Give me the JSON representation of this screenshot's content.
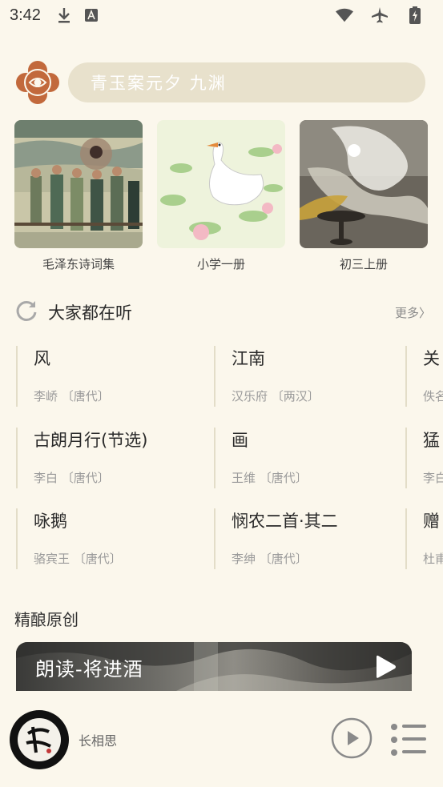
{
  "status": {
    "time": "3:42"
  },
  "search": {
    "text": "青玉案元夕 九渊"
  },
  "books": [
    {
      "caption": "毛泽东诗词集"
    },
    {
      "caption": "小学一册"
    },
    {
      "caption": "初三上册"
    }
  ],
  "popular": {
    "title": "大家都在听",
    "more": "更多〉",
    "poems": [
      {
        "title": "风",
        "author": "李峤 〔唐代〕"
      },
      {
        "title": "江南",
        "author": "汉乐府 〔两汉〕"
      },
      {
        "title": "关",
        "author": "佚名"
      },
      {
        "title": "古朗月行(节选)",
        "author": "李白 〔唐代〕"
      },
      {
        "title": "画",
        "author": "王维 〔唐代〕"
      },
      {
        "title": "猛",
        "author": "李白"
      },
      {
        "title": "咏鹅",
        "author": "骆宾王 〔唐代〕"
      },
      {
        "title": "悯农二首·其二",
        "author": "李绅 〔唐代〕"
      },
      {
        "title": "赠",
        "author": "杜甫"
      }
    ]
  },
  "original": {
    "title": "精酿原创",
    "banner_title": "朗读-将进酒"
  },
  "player": {
    "track": "长相思"
  },
  "colors": {
    "background": "#fbf7ec",
    "search_bg": "#e8e1cc",
    "logo": "#c2693c"
  }
}
